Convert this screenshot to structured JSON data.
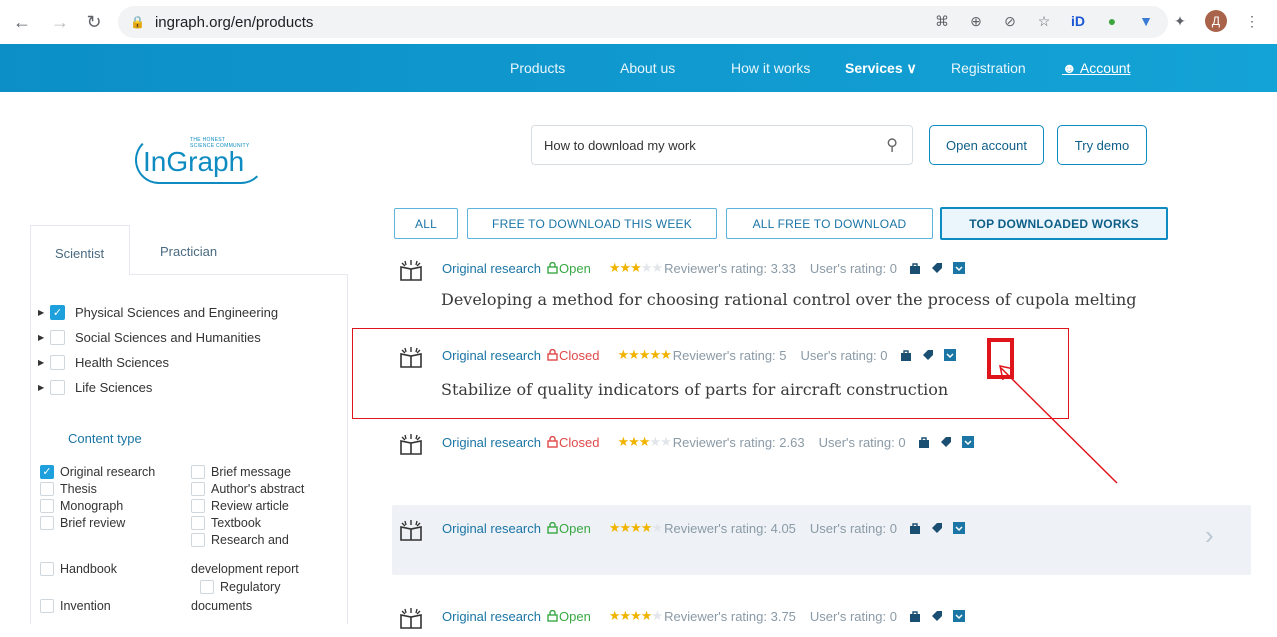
{
  "browser": {
    "url": "ingraph.org/en/products",
    "profile_initial": "Д"
  },
  "nav": {
    "items": [
      "Products",
      "About us",
      "How it works",
      "Services",
      "Registration",
      "Account"
    ],
    "services_chevron": "∨"
  },
  "logo": {
    "tagline_line1": "THE HONEST",
    "tagline_line2": "SCIENCE COMMUNITY",
    "name": "InGraph"
  },
  "search": {
    "value": "How to download my work",
    "open_account": "Open account",
    "try_demo": "Try demo"
  },
  "filters": [
    "ALL",
    "FREE TO DOWNLOAD THIS WEEK",
    "ALL FREE TO DOWNLOAD",
    "TOP DOWNLOADED WORKS"
  ],
  "sidebar": {
    "tabs": [
      "Scientist",
      "Practician"
    ],
    "categories": [
      {
        "label": "Physical Sciences and Engineering",
        "checked": true
      },
      {
        "label": "Social Sciences and Humanities",
        "checked": false
      },
      {
        "label": "Health Sciences",
        "checked": false
      },
      {
        "label": "Life Sciences",
        "checked": false
      }
    ],
    "content_type_title": "Content type",
    "content_types": {
      "original_research": "Original research",
      "brief_message": "Brief message",
      "thesis": "Thesis",
      "authors_abstract": "Author's abstract",
      "monograph": "Monograph",
      "review_article": "Review article",
      "brief_review": "Brief review",
      "textbook": "Textbook",
      "research_line1": "Research and",
      "handbook": "Handbook",
      "research_line2": "development report",
      "regulatory_line1": "Regulatory",
      "invention": "Invention",
      "regulatory_line2": "documents"
    }
  },
  "works": [
    {
      "type": "Original research",
      "access": "Open",
      "stars": 3,
      "reviewer": "Reviewer's rating: 3.33",
      "user": "User's rating: 0",
      "title": "Developing a method for choosing rational control over the process of cupola melting"
    },
    {
      "type": "Original research",
      "access": "Closed",
      "stars": 5,
      "reviewer": "Reviewer's rating: 5",
      "user": "User's rating: 0",
      "title": "Stabilize of quality indicators of parts for aircraft construction"
    },
    {
      "type": "Original research",
      "access": "Closed",
      "stars": 2.5,
      "reviewer": "Reviewer's rating: 2.63",
      "user": "User's rating: 0",
      "title": ""
    },
    {
      "type": "Original research",
      "access": "Open",
      "stars": 4,
      "reviewer": "Reviewer's rating: 4.05",
      "user": "User's rating: 0",
      "title": ""
    },
    {
      "type": "Original research",
      "access": "Open",
      "stars": 3.5,
      "reviewer": "Reviewer's rating: 3.75",
      "user": "User's rating: 0",
      "title": ""
    }
  ],
  "colors": {
    "brand": "#0e8cc2",
    "annotation": "#e0141b",
    "open": "#38a844",
    "closed": "#e04848",
    "star": "#f0b400"
  }
}
